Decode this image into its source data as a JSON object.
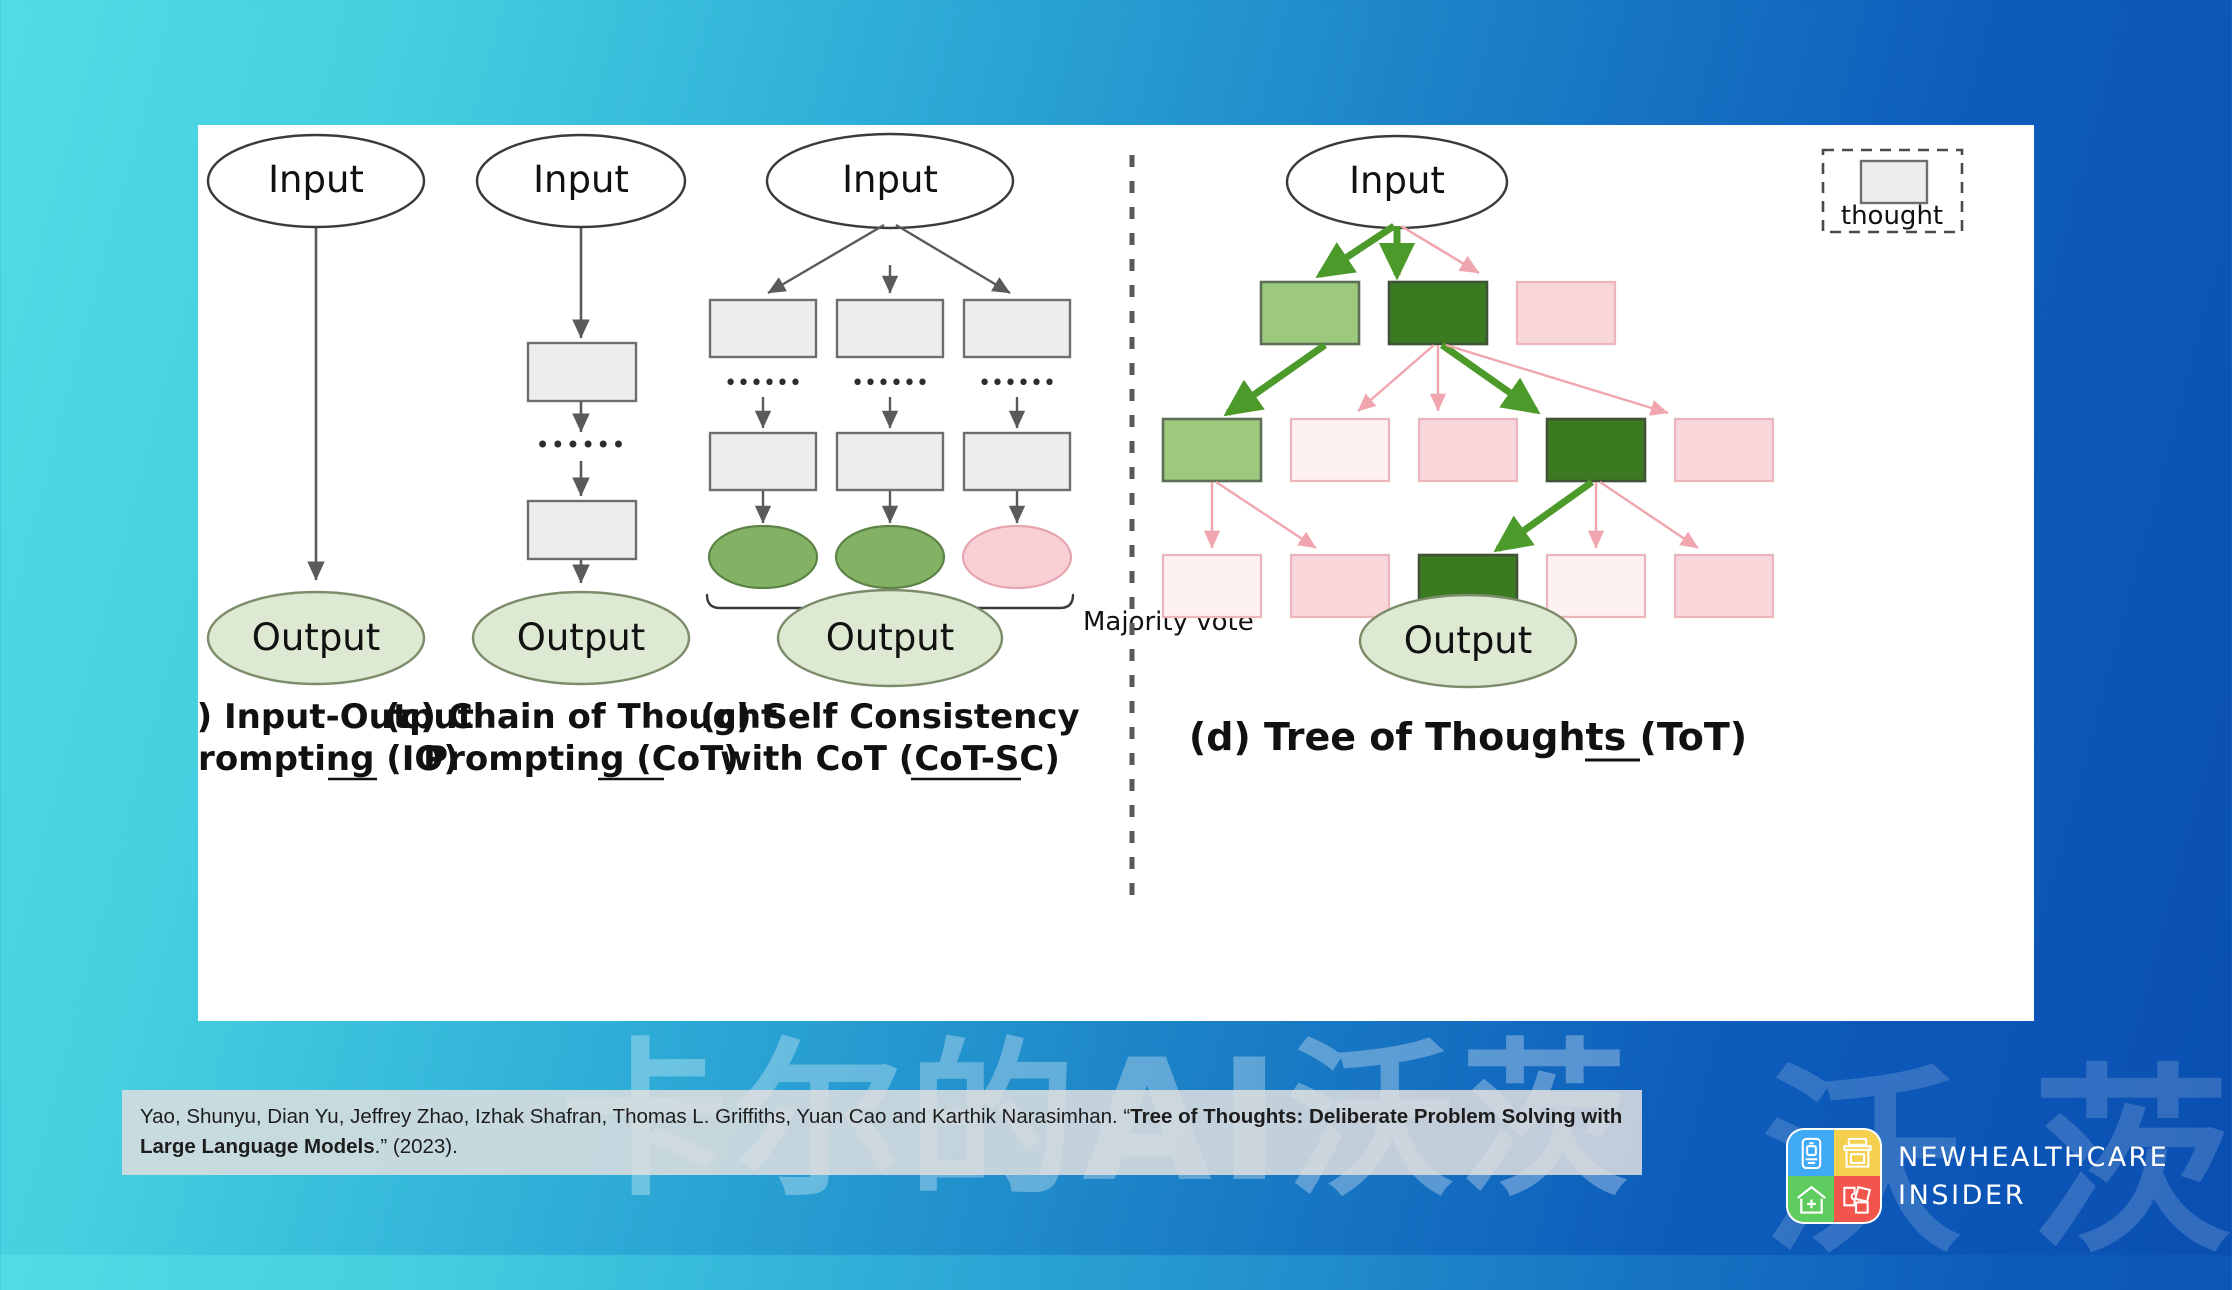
{
  "background": {
    "gradient_from": "#52DCE4",
    "gradient_to": "#0A4FB2",
    "watermark_text": "卡尔的AI沃茨"
  },
  "figure": {
    "legend": {
      "box_label": "thought"
    },
    "panels": [
      {
        "id": "io",
        "caption_line1": "(a) Input-Output",
        "caption_line2": "Prompting (IO)",
        "input_label": "Input",
        "output_label": "Output",
        "thought_count": 0
      },
      {
        "id": "cot",
        "caption_line1": "(c) Chain of Thought",
        "caption_line2": "Prompting (CoT)",
        "input_label": "Input",
        "output_label": "Output",
        "thought_count": 2,
        "ellipsis": "••••••"
      },
      {
        "id": "cot-sc",
        "caption_line1": "(c) Self Consistency",
        "caption_line2": "with CoT (CoT-SC)",
        "input_label": "Input",
        "output_label": "Output",
        "majority_vote_label": "Majority vote",
        "chains": 3,
        "chain_results": [
          "green",
          "green",
          "pink"
        ],
        "ellipsis": "••••••"
      },
      {
        "id": "tot",
        "caption": "(d) Tree of Thoughts (ToT)",
        "input_label": "Input",
        "output_label": "Output",
        "ellipsis": "••••••",
        "levels": [
          {
            "nodes": [
              "light-green",
              "dark-green",
              "pink"
            ]
          },
          {
            "nodes": [
              "light-green",
              "pale-pink",
              "pink",
              "dark-green",
              "pink"
            ]
          },
          {
            "nodes": [
              "pale-pink",
              "pink",
              "dark-green",
              "pale-pink",
              "pink"
            ]
          }
        ]
      }
    ],
    "colors": {
      "thought_gray": "#EDEDED",
      "thought_gray_border": "#6E6E6E",
      "output_green": "#DDE9D2",
      "output_green_border": "#7C8C6B",
      "vote_green": "#84B264",
      "vote_pink": "#F8CFD5",
      "tot_light_green": "#9CC97E",
      "tot_dark_green": "#3C7A22",
      "tot_pink": "#F9D6DA",
      "tot_pale_pink": "#FDF1F2",
      "arrow_green": "#4C9A2A",
      "arrow_pink": "#EFA6AE",
      "arrow_gray": "#5A5A5A"
    }
  },
  "citation": {
    "part1": "Yao, Shunyu, Dian Yu, Jeffrey Zhao, Izhak Shafran, Thomas L. Griffiths, Yuan Cao and Karthik Narasimhan. “",
    "bold": "Tree of Thoughts: Deliberate Problem Solving with Large Language Models",
    "part2": ".” (2023)."
  },
  "logo": {
    "line1": "NEWHEALTHCARE",
    "line2": "INSIDER",
    "quadrants": [
      {
        "name": "phone-icon",
        "color": "#3FA9F5"
      },
      {
        "name": "shop-icon",
        "color": "#F5D04E"
      },
      {
        "name": "hospital-home-icon",
        "color": "#5ECC5E"
      },
      {
        "name": "puzzle-icon",
        "color": "#F2554B"
      }
    ]
  }
}
